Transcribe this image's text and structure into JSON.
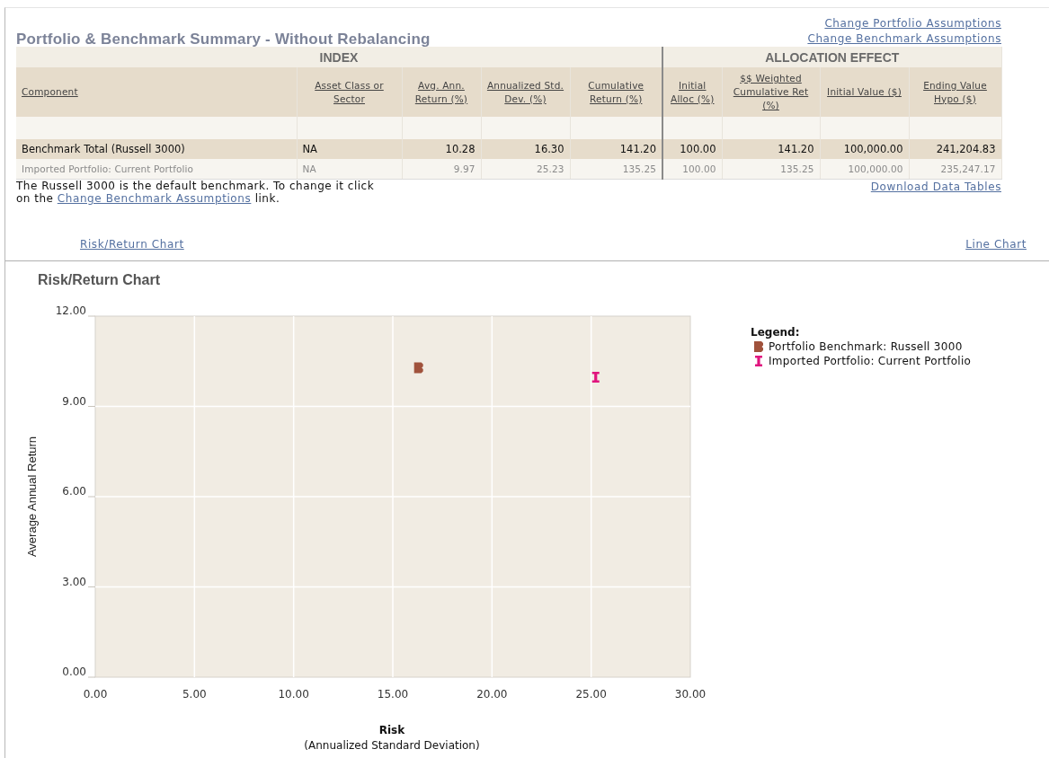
{
  "title": "Portfolio & Benchmark Summary - Without Rebalancing",
  "top_links": [
    "Change Portfolio Assumptions",
    "Change Benchmark Assumptions"
  ],
  "table": {
    "groups": [
      {
        "label": "INDEX",
        "columns": [
          "Component",
          "Asset Class or Sector",
          "Avg. Ann. Return (%)",
          "Annualized Std. Dev. (%)",
          "Cumulative Return (%)"
        ]
      },
      {
        "label": "ALLOCATION EFFECT",
        "columns": [
          "Initial Alloc (%)",
          "$$ Weighted Cumulative Ret (%)",
          "Initial Value ($)",
          "Ending Value Hypo ($)"
        ]
      }
    ],
    "rows": [
      {
        "kind": "benchmark",
        "cells": [
          "Benchmark Total (Russell 3000)",
          "NA",
          "10.28",
          "16.30",
          "141.20",
          "100.00",
          "141.20",
          "100,000.00",
          "241,204.83"
        ]
      },
      {
        "kind": "portfolio",
        "cells": [
          "Imported Portfolio:  Current Portfolio",
          "NA",
          "9.97",
          "25.23",
          "135.25",
          "100.00",
          "135.25",
          "100,000.00",
          "235,247.17"
        ]
      }
    ]
  },
  "note": {
    "before": "The Russell 3000 is the default benchmark. To change it click on the",
    "link": "Change Benchmark Assumptions",
    "after": "link."
  },
  "download_link": "Download Data Tables",
  "chart_links": [
    "Risk/Return Chart",
    "Line Chart"
  ],
  "chart_title": "Risk/Return Chart",
  "chart_data": {
    "type": "scatter",
    "grid": true,
    "xlabel": "Risk",
    "ylabel": "Average Annual Return",
    "xlim": [
      0,
      30
    ],
    "ylim": [
      0,
      12
    ],
    "xticks": [
      {
        "value": 0,
        "label": "0.00"
      },
      {
        "value": 5,
        "label": "5.00"
      },
      {
        "value": 10,
        "label": "10.00"
      },
      {
        "value": 15,
        "label": "15.00"
      },
      {
        "value": 20,
        "label": "20.00"
      },
      {
        "value": 25,
        "label": "25.00"
      },
      {
        "value": 30,
        "label": "30.00"
      }
    ],
    "yticks": [
      {
        "value": 0,
        "label": "0.00"
      },
      {
        "value": 3,
        "label": "3.00"
      },
      {
        "value": 6,
        "label": "6.00"
      },
      {
        "value": 9,
        "label": "9.00"
      },
      {
        "value": 12,
        "label": "12.00"
      }
    ],
    "series": [
      {
        "name": "Portfolio Benchmark: Russell 3000",
        "color": "#a0523c",
        "x": [
          16.3
        ],
        "values": [
          10.28
        ]
      },
      {
        "name": "Imported Portfolio: Current Portfolio",
        "color": "#e0157f",
        "x": [
          25.23
        ],
        "values": [
          9.97
        ]
      }
    ]
  },
  "xlabel_note": "(Annualized Standard Deviation)",
  "plot_markers": [
    {
      "kind": "block"
    },
    {
      "kind": "ibeam"
    }
  ],
  "legend": {
    "title": "Legend:"
  }
}
